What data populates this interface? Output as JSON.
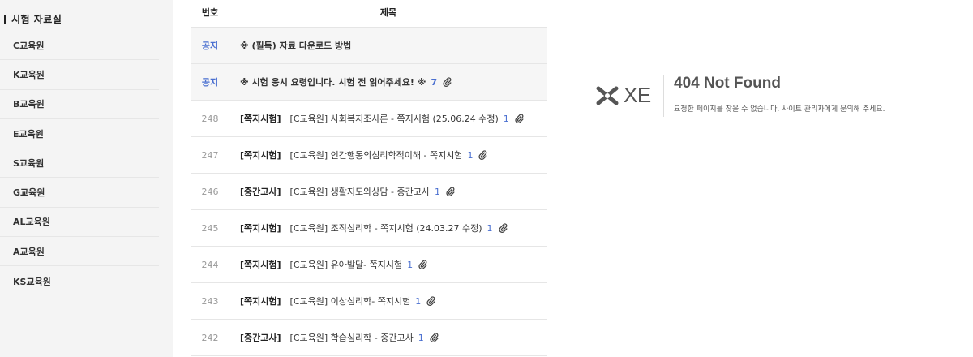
{
  "sidebar": {
    "title": "시험 자료실",
    "items": [
      {
        "label": "C교육원"
      },
      {
        "label": "K교육원"
      },
      {
        "label": "B교육원"
      },
      {
        "label": "E교육원"
      },
      {
        "label": "S교육원"
      },
      {
        "label": "G교육원"
      },
      {
        "label": "AL교육원"
      },
      {
        "label": "A교육원"
      },
      {
        "label": "KS교육원"
      }
    ]
  },
  "board": {
    "header": {
      "no": "번호",
      "title": "제목"
    },
    "rows": [
      {
        "no": "공지",
        "category": "",
        "title": "※ (필독) 자료 다운로드 방법",
        "comments": "",
        "attachment": false,
        "notice": true
      },
      {
        "no": "공지",
        "category": "",
        "title": "※ 시험 응시 요령입니다. 시험 전 읽어주세요! ※",
        "comments": "7",
        "attachment": true,
        "notice": true
      },
      {
        "no": "248",
        "category": "[쪽지시험]",
        "title": "[C교육원] 사회복지조사론 - 쪽지시험 (25.06.24 수정)",
        "comments": "1",
        "attachment": true,
        "notice": false
      },
      {
        "no": "247",
        "category": "[쪽지시험]",
        "title": "[C교육원] 인간행동의심리학적이해 - 쪽지시험",
        "comments": "1",
        "attachment": true,
        "notice": false
      },
      {
        "no": "246",
        "category": "[중간고사]",
        "title": "[C교육원] 생활지도와상담 - 중간고사",
        "comments": "1",
        "attachment": true,
        "notice": false
      },
      {
        "no": "245",
        "category": "[쪽지시험]",
        "title": "[C교육원] 조직심리학 - 쪽지시험 (24.03.27 수정)",
        "comments": "1",
        "attachment": true,
        "notice": false
      },
      {
        "no": "244",
        "category": "[쪽지시험]",
        "title": "[C교육원] 유아발달- 쪽지시험",
        "comments": "1",
        "attachment": true,
        "notice": false
      },
      {
        "no": "243",
        "category": "[쪽지시험]",
        "title": "[C교육원] 이상심리학- 쪽지시험",
        "comments": "1",
        "attachment": true,
        "notice": false
      },
      {
        "no": "242",
        "category": "[중간고사]",
        "title": "[C교육원] 학습심리학 - 중간고사",
        "comments": "1",
        "attachment": true,
        "notice": false
      }
    ]
  },
  "error": {
    "logo_text": "XE",
    "title": "404 Not Found",
    "message": "요청한 페이지를 찾을 수 없습니다. 사이트 관리자에게 문의해 주세요."
  },
  "colors": {
    "accent": "#4a6fd0",
    "sidebar_bg": "#f4f4f4",
    "notice_bg": "#f6f6f6"
  }
}
